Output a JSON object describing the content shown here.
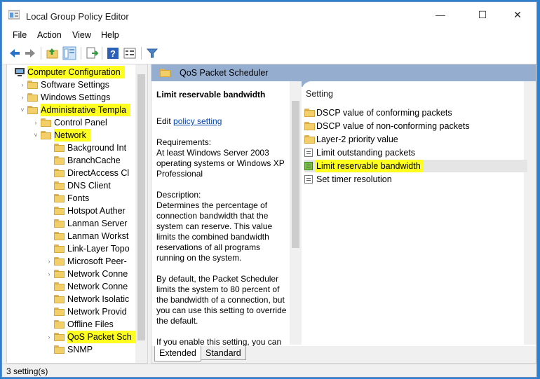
{
  "window": {
    "title": "Local Group Policy Editor",
    "minimize": "—",
    "maximize": "☐",
    "close": "✕"
  },
  "menu": [
    "File",
    "Action",
    "View",
    "Help"
  ],
  "tree": {
    "items": [
      {
        "label": "Computer Configuration",
        "level": 0,
        "expander": "",
        "highlighted": true,
        "icon": "computer-icon"
      },
      {
        "label": "Software Settings",
        "level": 1,
        "expander": "›",
        "highlighted": false
      },
      {
        "label": "Windows Settings",
        "level": 1,
        "expander": "›",
        "highlighted": false
      },
      {
        "label": "Administrative Templa",
        "level": 1,
        "expander": "˅",
        "highlighted": true
      },
      {
        "label": "Control Panel",
        "level": 2,
        "expander": "›",
        "highlighted": false
      },
      {
        "label": "Network",
        "level": 2,
        "expander": "˅",
        "highlighted": true
      },
      {
        "label": "Background Int",
        "level": 3,
        "expander": "",
        "highlighted": false
      },
      {
        "label": "BranchCache",
        "level": 3,
        "expander": "",
        "highlighted": false
      },
      {
        "label": "DirectAccess Cl",
        "level": 3,
        "expander": "",
        "highlighted": false
      },
      {
        "label": "DNS Client",
        "level": 3,
        "expander": "",
        "highlighted": false
      },
      {
        "label": "Fonts",
        "level": 3,
        "expander": "",
        "highlighted": false
      },
      {
        "label": "Hotspot Auther",
        "level": 3,
        "expander": "",
        "highlighted": false
      },
      {
        "label": "Lanman Server",
        "level": 3,
        "expander": "",
        "highlighted": false
      },
      {
        "label": "Lanman Workst",
        "level": 3,
        "expander": "",
        "highlighted": false
      },
      {
        "label": "Link-Layer Topo",
        "level": 3,
        "expander": "",
        "highlighted": false
      },
      {
        "label": "Microsoft Peer-",
        "level": 3,
        "expander": "›",
        "highlighted": false
      },
      {
        "label": "Network Conne",
        "level": 3,
        "expander": "›",
        "highlighted": false
      },
      {
        "label": "Network Conne",
        "level": 3,
        "expander": "",
        "highlighted": false
      },
      {
        "label": "Network Isolatic",
        "level": 3,
        "expander": "",
        "highlighted": false
      },
      {
        "label": "Network Provid",
        "level": 3,
        "expander": "",
        "highlighted": false
      },
      {
        "label": "Offline Files",
        "level": 3,
        "expander": "",
        "highlighted": false
      },
      {
        "label": "QoS Packet Sch",
        "level": 3,
        "expander": "›",
        "highlighted": true
      },
      {
        "label": "SNMP",
        "level": 3,
        "expander": "",
        "highlighted": false
      }
    ]
  },
  "header": {
    "folder": "QoS Packet Scheduler"
  },
  "description": {
    "title": "Limit reservable bandwidth",
    "edit_prefix": "Edit",
    "edit_link": "policy setting",
    "requirements": "Requirements:\nAt least Windows Server 2003 operating systems or Windows XP Professional",
    "description": "Description:\nDetermines the percentage of connection bandwidth that the system can reserve. This value limits the combined bandwidth reservations of all programs running on the system.",
    "default_text": "By default, the Packet Scheduler limits the system to 80 percent of the bandwidth of a connection, but you can use this setting to override the default.",
    "enable_text": "If you enable this setting, you can use the \"Bandwidth limit\" box to"
  },
  "settings": {
    "column": "Setting",
    "items": [
      {
        "label": "DSCP value of conforming packets",
        "type": "folder",
        "highlighted": false
      },
      {
        "label": "DSCP value of non-conforming packets",
        "type": "folder",
        "highlighted": false
      },
      {
        "label": "Layer-2 priority value",
        "type": "folder",
        "highlighted": false
      },
      {
        "label": "Limit outstanding packets",
        "type": "setting",
        "highlighted": false
      },
      {
        "label": "Limit reservable bandwidth",
        "type": "setting-enabled",
        "highlighted": true
      },
      {
        "label": "Set timer resolution",
        "type": "setting",
        "highlighted": false
      }
    ]
  },
  "tabs": [
    "Extended",
    "Standard"
  ],
  "status": "3 setting(s)"
}
